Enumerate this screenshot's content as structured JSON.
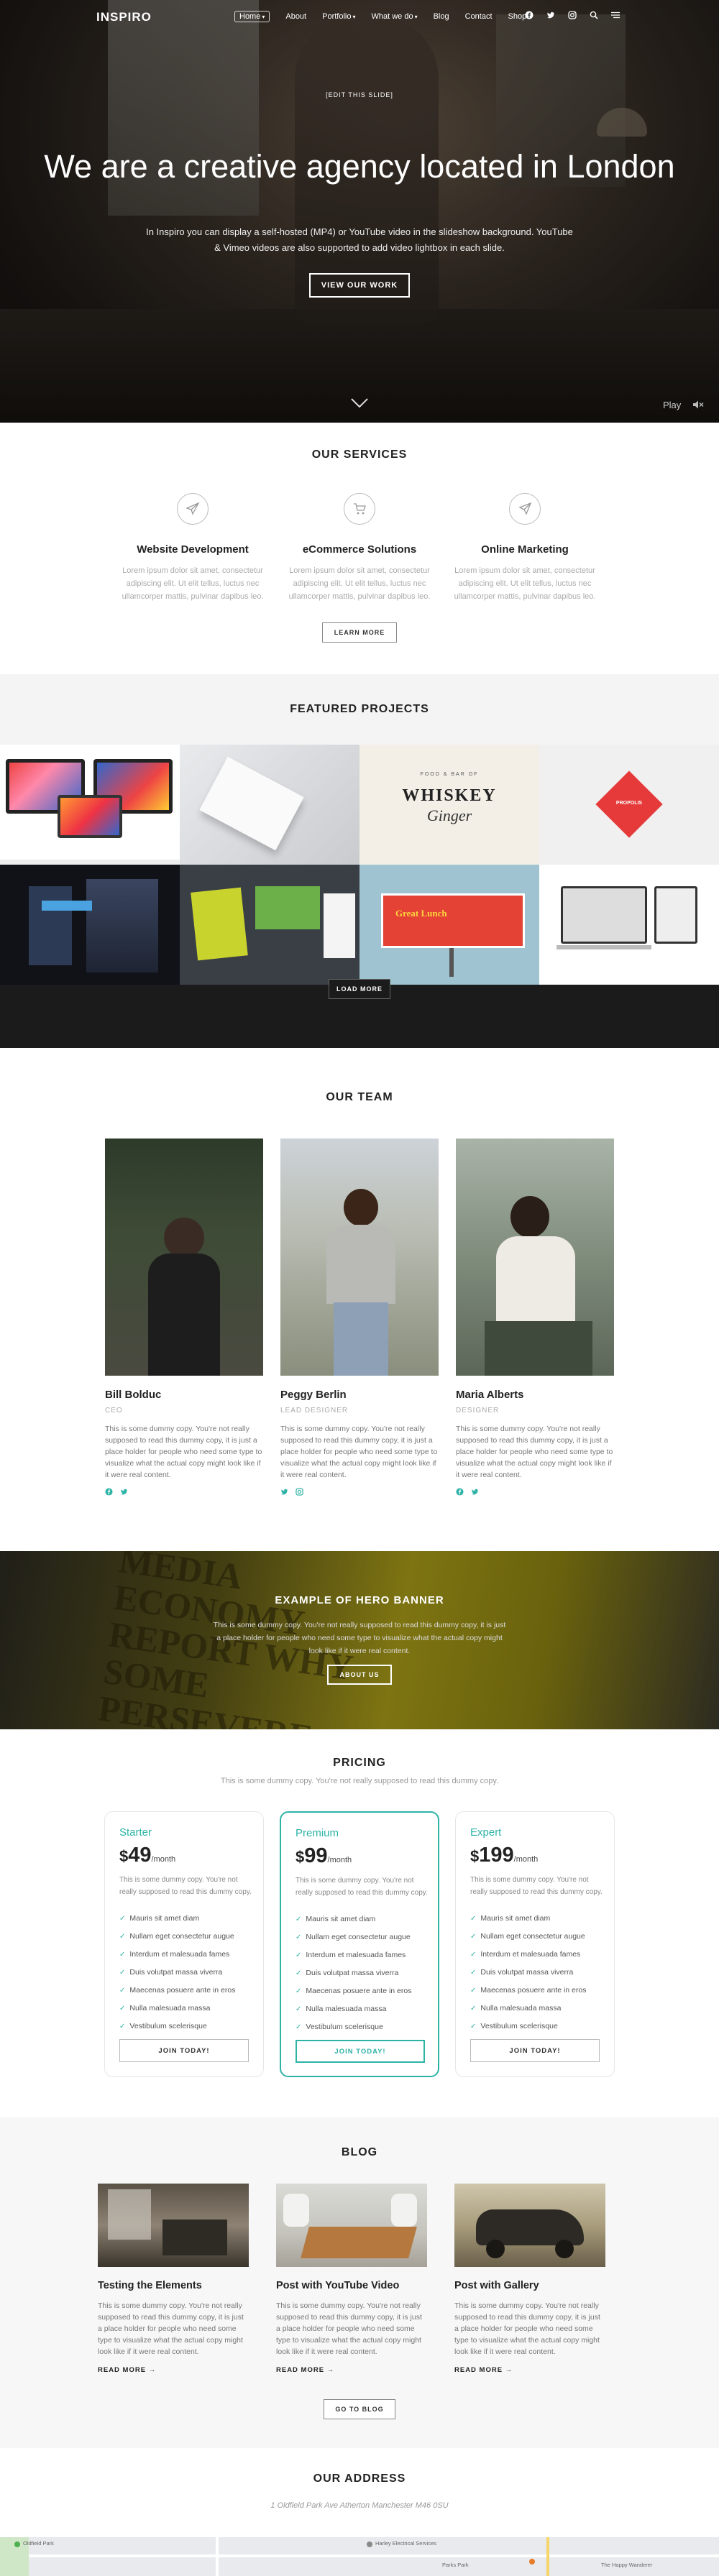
{
  "nav": {
    "logo": "INSPIRO",
    "items": [
      "Home",
      "About",
      "Portfolio",
      "What we do",
      "Blog",
      "Contact",
      "Shop"
    ],
    "caret": "▾"
  },
  "hero": {
    "subtitle": "[EDIT THIS SLIDE]",
    "title": "We are a creative agency located in London",
    "text": "In Inspiro you can display a self-hosted (MP4) or YouTube video in the slideshow background. YouTube & Vimeo videos are also supported to add video lightbox in each slide.",
    "button": "VIEW OUR WORK",
    "play": "Play"
  },
  "services": {
    "title": "OUR SERVICES",
    "items": [
      {
        "title": "Website Development",
        "text": "Lorem ipsum dolor sit amet, consectetur adipiscing elit. Ut elit tellus, luctus nec ullamcorper mattis, pulvinar dapibus leo.",
        "icon": "paper-plane-icon"
      },
      {
        "title": "eCommerce Solutions",
        "text": "Lorem ipsum dolor sit amet, consectetur adipiscing elit. Ut elit tellus, luctus nec ullamcorper mattis, pulvinar dapibus leo.",
        "icon": "cart-icon"
      },
      {
        "title": "Online Marketing",
        "text": "Lorem ipsum dolor sit amet, consectetur adipiscing elit. Ut elit tellus, luctus nec ullamcorper mattis, pulvinar dapibus leo.",
        "icon": "send-icon"
      }
    ],
    "button": "LEARN MORE"
  },
  "projects": {
    "title": "FEATURED PROJECTS",
    "tile_text": {
      "whiskey_small": "FOOD & BAR OF",
      "whiskey": "WHISKEY",
      "ginger": "Ginger",
      "diamond": "PROPOLIS",
      "billboard": "Great Lunch"
    },
    "button": "LOAD MORE"
  },
  "team": {
    "title": "OUR TEAM",
    "members": [
      {
        "name": "Bill Bolduc",
        "role": "CEO",
        "text": "This is some dummy copy. You're not really supposed to read this dummy copy, it is just a place holder for people who need some type to visualize what the actual copy might look like if it were real content."
      },
      {
        "name": "Peggy Berlin",
        "role": "LEAD DESIGNER",
        "text": "This is some dummy copy. You're not really supposed to read this dummy copy, it is just a place holder for people who need some type to visualize what the actual copy might look like if it were real content."
      },
      {
        "name": "Maria Alberts",
        "role": "DESIGNER",
        "text": "This is some dummy copy. You're not really supposed to read this dummy copy, it is just a place holder for people who need some type to visualize what the actual copy might look like if it were real content."
      }
    ]
  },
  "banner": {
    "title": "EXAMPLE OF HERO BANNER",
    "text": "This is some dummy copy. You're not really supposed to read this dummy copy, it is just a place holder for people who need some type to visualize what the actual copy might look like if it were real content.",
    "button": "ABOUT US",
    "book_text": "MEDIA ECONOMY REPORT WHY SOME PERSEVERE"
  },
  "pricing": {
    "title": "PRICING",
    "subtitle": "This is some dummy copy. You're not really supposed to read this dummy copy.",
    "plans": [
      {
        "name": "Starter",
        "currency": "$",
        "price": "49",
        "per": "/month",
        "desc": "This is some dummy copy. You're not really supposed to read this dummy copy.",
        "button": "JOIN TODAY!"
      },
      {
        "name": "Premium",
        "currency": "$",
        "price": "99",
        "per": "/month",
        "desc": "This is some dummy copy. You're not really supposed to read this dummy copy.",
        "button": "JOIN TODAY!"
      },
      {
        "name": "Expert",
        "currency": "$",
        "price": "199",
        "per": "/month",
        "desc": "This is some dummy copy. You're not really supposed to read this dummy copy.",
        "button": "JOIN TODAY!"
      }
    ],
    "features": [
      "Mauris sit amet diam",
      "Nullam eget consectetur augue",
      "Interdum et malesuada fames",
      "Duis volutpat massa viverra",
      "Maecenas posuere ante in eros",
      "Nulla malesuada massa",
      "Vestibulum scelerisque"
    ],
    "accent": "#2db3a6"
  },
  "blog": {
    "title": "BLOG",
    "posts": [
      {
        "title": "Testing the Elements",
        "text": "This is some dummy copy. You're not really supposed to read this dummy copy, it is just a place holder for people who need some type to visualize what the actual copy might look like if it were real content.",
        "more": "READ MORE →"
      },
      {
        "title": "Post with YouTube Video",
        "text": "This is some dummy copy. You're not really supposed to read this dummy copy, it is just a place holder for people who need some type to visualize what the actual copy might look like if it were real content.",
        "more": "READ MORE →"
      },
      {
        "title": "Post with Gallery",
        "text": "This is some dummy copy. You're not really supposed to read this dummy copy, it is just a place holder for people who need some type to visualize what the actual copy might look like if it were real content.",
        "more": "READ MORE →"
      }
    ],
    "button": "GO TO BLOG"
  },
  "address": {
    "title": "OUR ADDRESS",
    "line": "1 Oldfield Park Ave Atherton Manchester M46 0SU",
    "map_labels": [
      "Oldfield Park",
      "Harley Electrical Services",
      "Parks Park",
      "The Happy Wanderer"
    ]
  }
}
